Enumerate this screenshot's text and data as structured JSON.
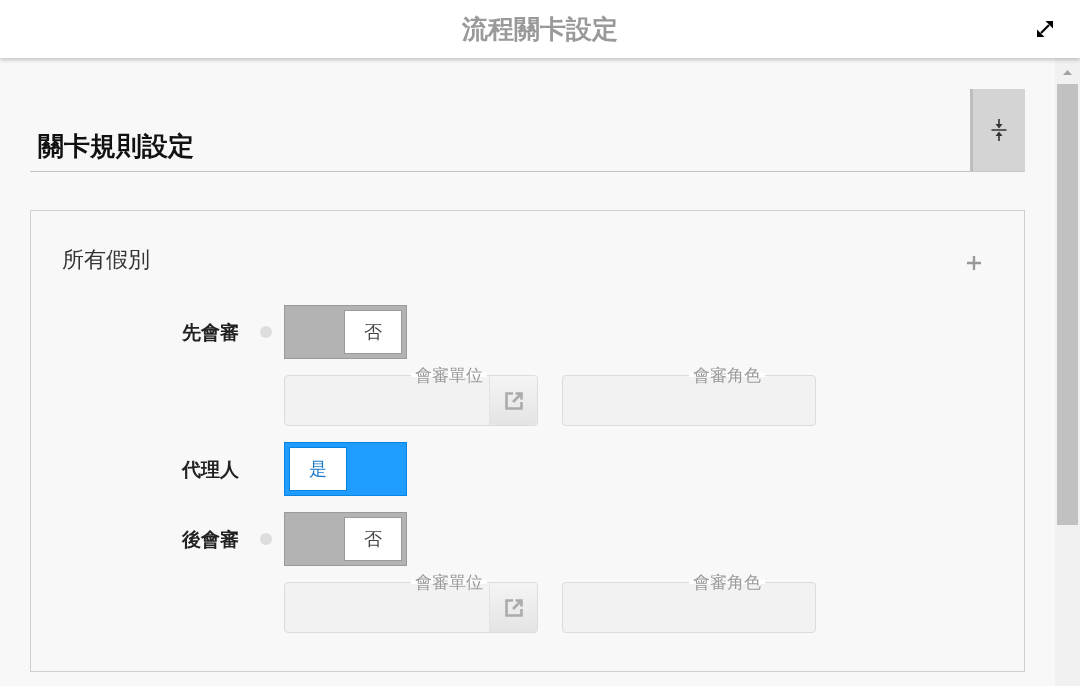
{
  "window": {
    "title": "流程關卡設定"
  },
  "section": {
    "title": "關卡規則設定"
  },
  "panel": {
    "title": "所有假別",
    "rows": [
      {
        "label": "先會審",
        "indicator": true,
        "toggle": {
          "on": false,
          "text": "否"
        },
        "fields": [
          {
            "kind": "picker",
            "label": "會審單位"
          },
          {
            "kind": "text",
            "label": "會審角色"
          }
        ]
      },
      {
        "label": "代理人",
        "indicator": false,
        "toggle": {
          "on": true,
          "text": "是"
        }
      },
      {
        "label": "後會審",
        "indicator": true,
        "toggle": {
          "on": false,
          "text": "否"
        },
        "fields": [
          {
            "kind": "picker",
            "label": "會審單位"
          },
          {
            "kind": "text",
            "label": "會審角色"
          }
        ]
      }
    ]
  }
}
